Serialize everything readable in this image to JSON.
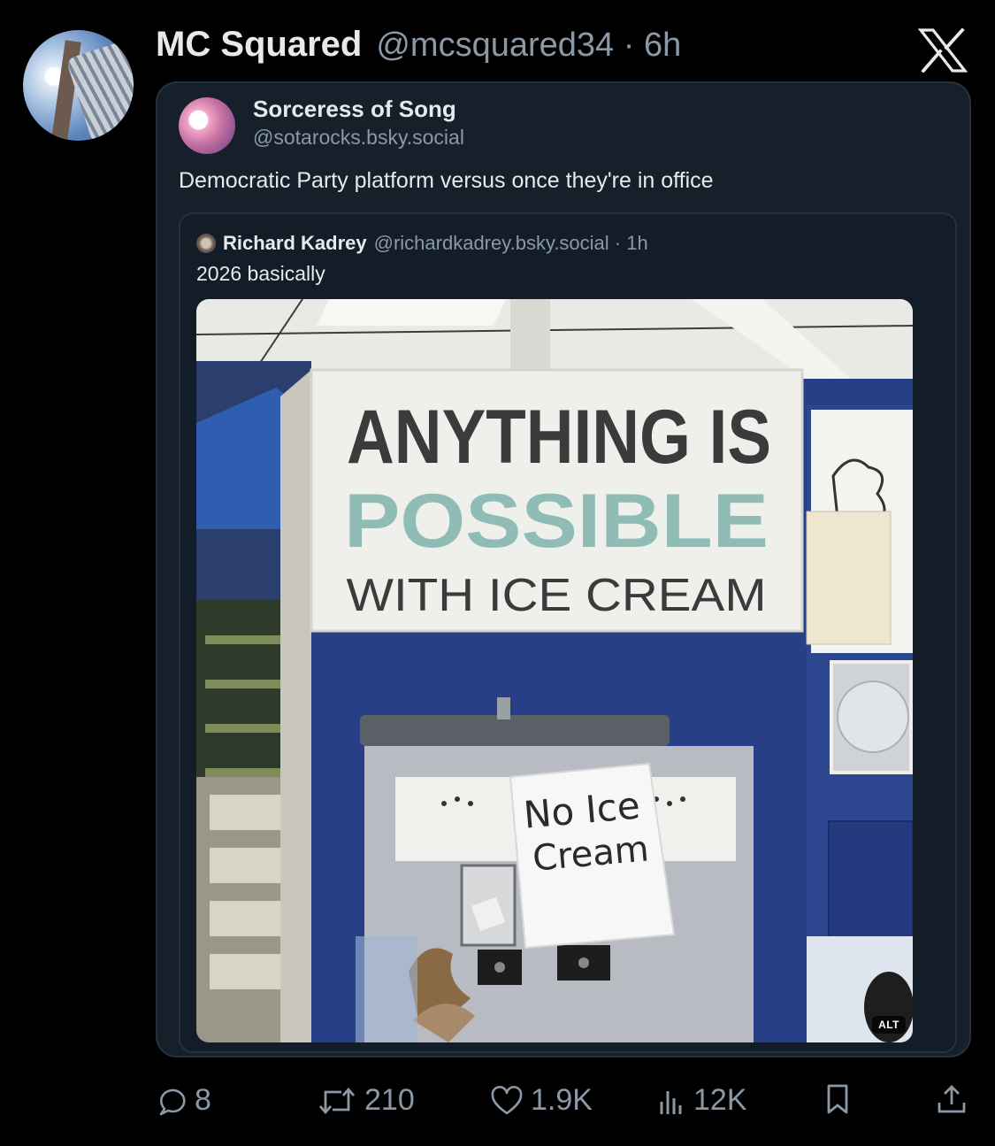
{
  "post": {
    "display_name": "MC Squared",
    "handle_time": "@mcsquared34 · 6h",
    "logo": "x-logo-icon"
  },
  "quote": {
    "name": "Sorceress of Song",
    "handle": "@sotarocks.bsky.social",
    "text": "Democratic Party platform versus once they're in office"
  },
  "inner": {
    "name": "Richard Kadrey",
    "meta": "@richardkadrey.bsky.social · 1h",
    "text": "2026 basically"
  },
  "photo": {
    "sign_line1": "ANYTHING IS",
    "sign_line2": "POSSIBLE",
    "sign_line3": "WITH ICE CREAM",
    "note_line1": "No Ice",
    "note_line2": "Cream",
    "alt_label": "ALT"
  },
  "actions": {
    "replies": "8",
    "reposts": "210",
    "likes": "1.9K",
    "views": "12K"
  },
  "colors": {
    "background": "#000000",
    "card": "#15202b",
    "muted": "#8b98a5",
    "text": "#e7e9ea",
    "machine_blue": "#263f87",
    "possible_teal": "#8fbcb4"
  }
}
